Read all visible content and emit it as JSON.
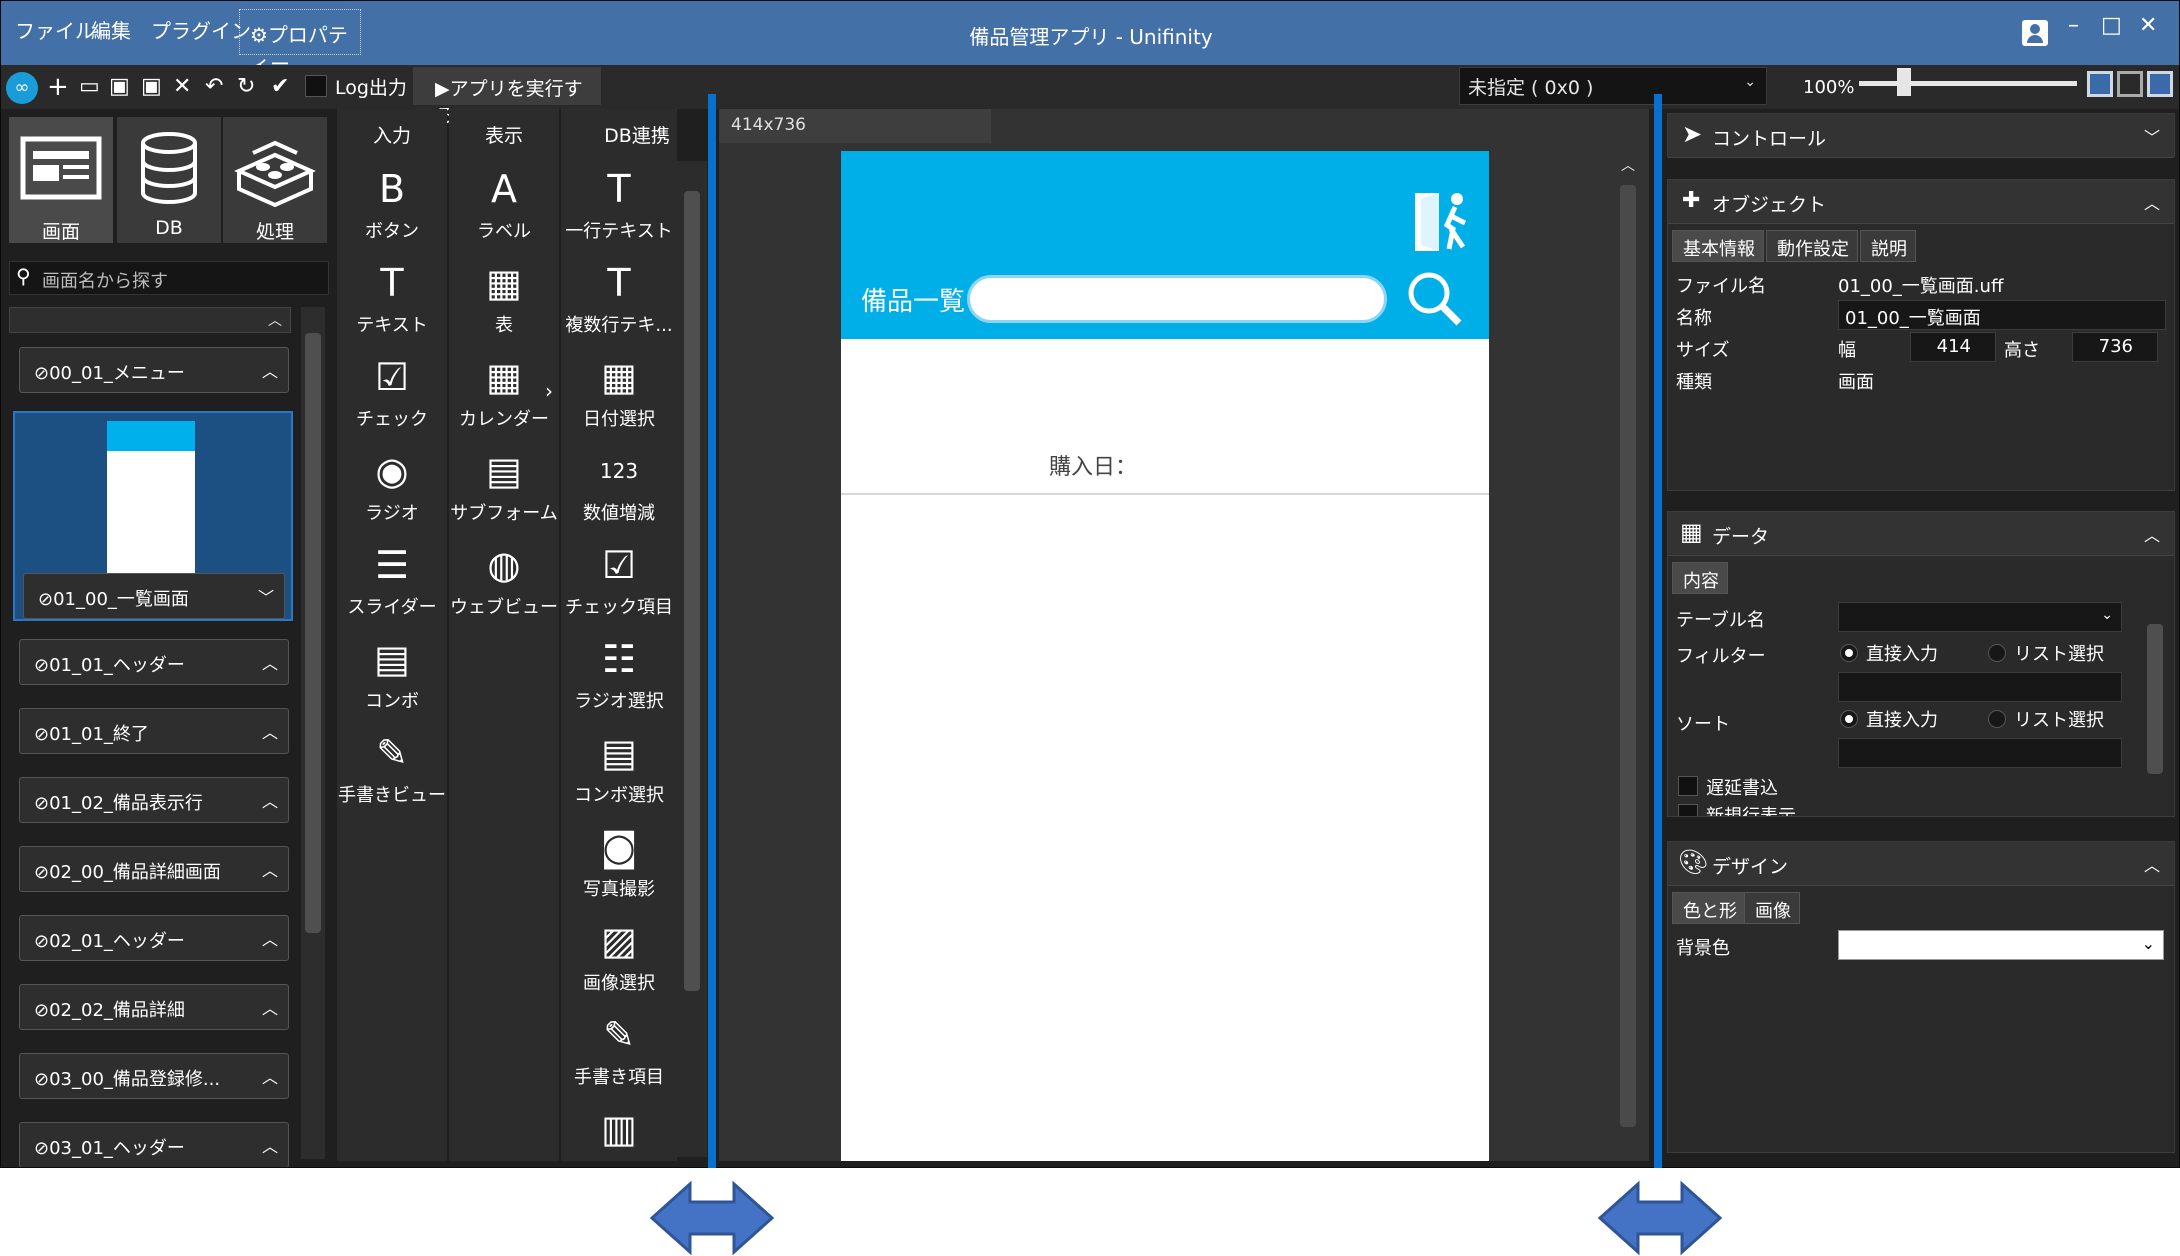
{
  "menu": {
    "file": "ファイル",
    "edit": "編集",
    "plugin": "プラグイン",
    "property": "⚙プロパティー"
  },
  "app_title": "備品管理アプリ - Unifinity",
  "window_buttons": {
    "minimize": "–",
    "maximize": "□",
    "close": "✕"
  },
  "toolbar": {
    "log_label": "Log出力",
    "run_label": "▶アプリを実行する",
    "device_select": "未指定 ( 0x0 )",
    "zoom": "100%"
  },
  "left": {
    "tabs": [
      {
        "label": "画面"
      },
      {
        "label": "DB"
      },
      {
        "label": "処理"
      }
    ],
    "search_placeholder": "画面名から探す",
    "screens": [
      {
        "label": "⊘00_01_メニュー"
      },
      {
        "label": "⊘01_00_一覧画面"
      },
      {
        "label": "⊘01_01_ヘッダー"
      },
      {
        "label": "⊘01_01_終了"
      },
      {
        "label": "⊘01_02_備品表示行"
      },
      {
        "label": "⊘02_00_備品詳細画面"
      },
      {
        "label": "⊘02_01_ヘッダー"
      },
      {
        "label": "⊘02_02_備品詳細"
      },
      {
        "label": "⊘03_00_備品登録修..."
      },
      {
        "label": "⊘03_01_ヘッダー"
      }
    ]
  },
  "palette": {
    "headers": {
      "input": "入力",
      "display": "表示",
      "db": "DB連携"
    },
    "input": [
      {
        "glyph": "B",
        "label": "ボタン"
      },
      {
        "glyph": "T",
        "label": "テキスト"
      },
      {
        "glyph": "☑",
        "label": "チェック"
      },
      {
        "glyph": "◉",
        "label": "ラジオ"
      },
      {
        "glyph": "☰",
        "label": "スライダー"
      },
      {
        "glyph": "▤",
        "label": "コンボ"
      },
      {
        "glyph": "✎",
        "label": "手書きビュー"
      }
    ],
    "display": [
      {
        "glyph": "A",
        "label": "ラベル"
      },
      {
        "glyph": "▦",
        "label": "表"
      },
      {
        "glyph": "▦",
        "label": "カレンダー"
      },
      {
        "glyph": "▤",
        "label": "サブフォーム"
      },
      {
        "glyph": "◍",
        "label": "ウェブビュー"
      }
    ],
    "db": [
      {
        "glyph": "T",
        "label": "一行テキスト"
      },
      {
        "glyph": "T",
        "label": "複数行テキ..."
      },
      {
        "glyph": "▦",
        "label": "日付選択"
      },
      {
        "glyph": "123",
        "label": "数値増減"
      },
      {
        "glyph": "☑",
        "label": "チェック項目"
      },
      {
        "glyph": "☷",
        "label": "ラジオ選択"
      },
      {
        "glyph": "▤",
        "label": "コンボ選択"
      },
      {
        "glyph": "◙",
        "label": "写真撮影"
      },
      {
        "glyph": "▨",
        "label": "画像選択"
      },
      {
        "glyph": "✎",
        "label": "手書き項目"
      },
      {
        "glyph": "▥",
        "label": ""
      }
    ]
  },
  "canvas": {
    "size_tab": "414x736",
    "phone_title": "備品一覧",
    "date_label": "購入日：",
    "accent": "#00AEE8"
  },
  "right": {
    "control": {
      "title": "コントロール"
    },
    "object": {
      "title": "オブジェクト",
      "tabs": [
        "基本情報",
        "動作設定",
        "説明"
      ],
      "file_label": "ファイル名",
      "file_value": "01_00_一覧画面.uff",
      "name_label": "名称",
      "name_value": "01_00_一覧画面",
      "size_label": "サイズ",
      "width_label": "幅",
      "width_value": "414",
      "height_label": "高さ",
      "height_value": "736",
      "type_label": "種類",
      "type_value": "画面"
    },
    "data": {
      "title": "データ",
      "tab": "内容",
      "table_label": "テーブル名",
      "filter_label": "フィルター",
      "sort_label": "ソート",
      "direct": "直接入力",
      "list": "リスト選択",
      "lazy_label": "遅延書込",
      "newline_label": "新規行表示"
    },
    "design": {
      "title": "デザイン",
      "tabs": [
        "色と形",
        "画像"
      ],
      "bg_label": "背景色"
    }
  }
}
